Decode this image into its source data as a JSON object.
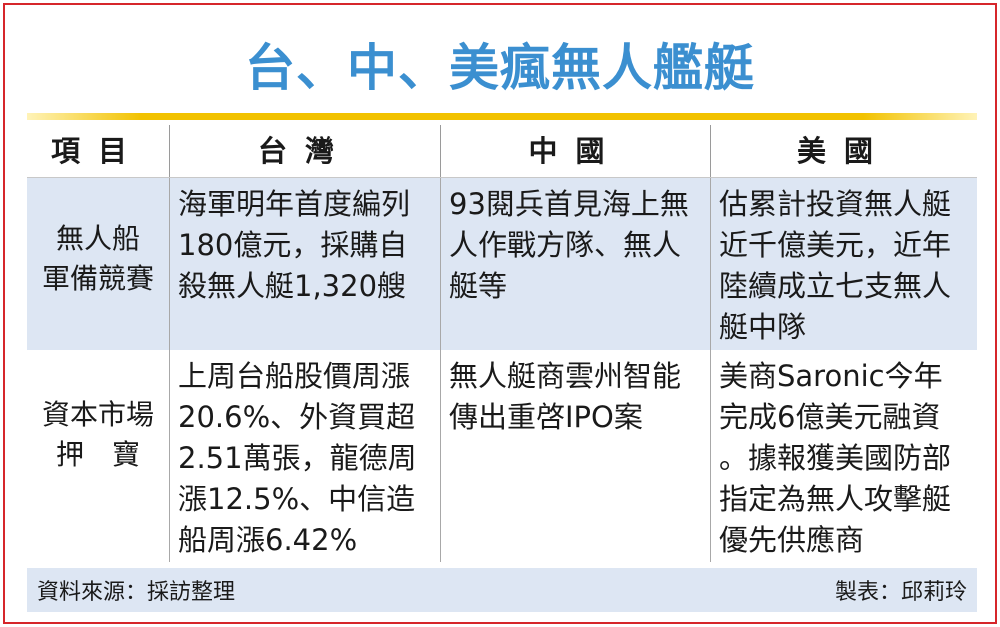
{
  "title": "台、中、美瘋無人艦艇",
  "table": {
    "headers": [
      "項目",
      "台灣",
      "中國",
      "美國"
    ],
    "rows": [
      {
        "label": "無人船\n軍備競賽",
        "taiwan": "海軍明年首度編列\n180億元，採購自\n殺無人艇1,320艘",
        "china": "93閱兵首見海上無\n人作戰方隊、無人\n艇等",
        "usa": "估累計投資無人艇\n近千億美元，近年\n陸續成立七支無人\n艇中隊"
      },
      {
        "label": "資本市場\n押　寶",
        "taiwan": "上周台船股價周漲\n20.6%、外資買超\n2.51萬張，龍德周\n漲12.5%、中信造\n船周漲6.42%",
        "china": "無人艇商雲州智能\n傳出重啓IPO案",
        "usa": "美商Saronic今年\n完成6億美元融資\n。據報獲美國防部\n指定為無人攻擊艇\n優先供應商"
      }
    ]
  },
  "footer": {
    "source": "資料來源：採訪整理",
    "author": "製表：邱莉玲"
  },
  "colors": {
    "title": "#3b8fd0",
    "border": "#d6262b",
    "rule": "#f2c200",
    "shade": "#dde6f3"
  }
}
